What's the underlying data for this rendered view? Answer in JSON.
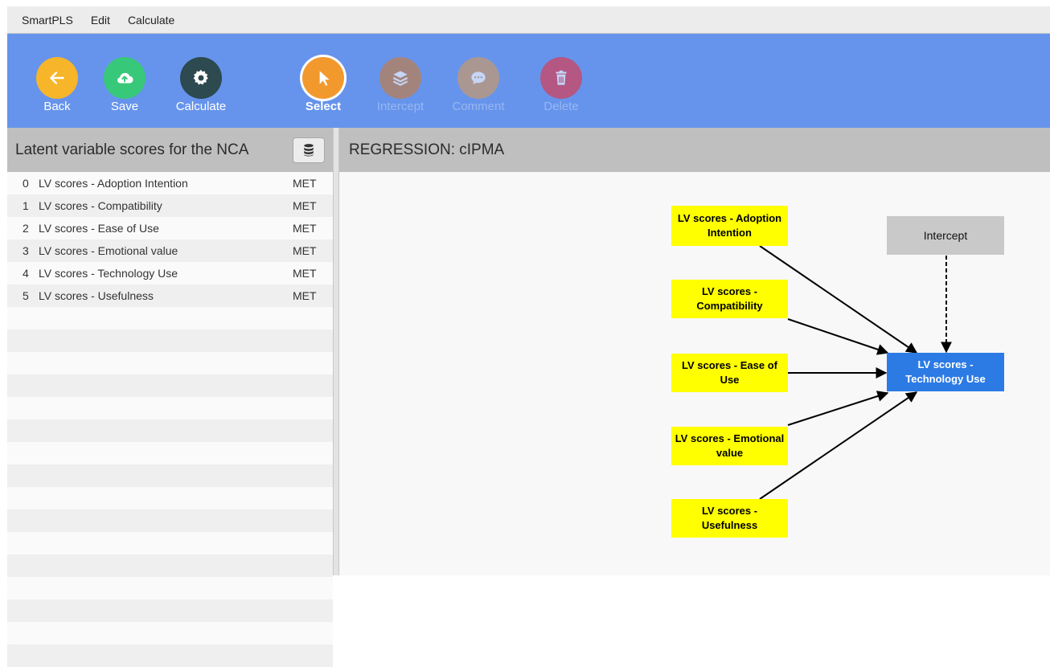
{
  "menu": [
    "SmartPLS",
    "Edit",
    "Calculate"
  ],
  "toolbar": {
    "back": "Back",
    "save": "Save",
    "calculate": "Calculate",
    "select": "Select",
    "intercept": "Intercept",
    "comment": "Comment",
    "delete": "Delete"
  },
  "colors": {
    "back": "#f7b529",
    "save": "#38c87a",
    "calculate": "#2c4a4f",
    "select": "#f2992e",
    "intercept": "#c97b3a",
    "comment": "#d49a5c",
    "delete": "#e53344"
  },
  "icons": {
    "back": "arrow-left-icon",
    "save": "cloud-upload-icon",
    "calculate": "gear-icon",
    "select": "cursor-arrow-icon",
    "intercept": "layers-icon",
    "comment": "speech-bubble-icon",
    "delete": "trash-icon",
    "database": "database-icon"
  },
  "left_panel": {
    "title": "Latent variable scores for the NCA",
    "items": [
      {
        "index": "0",
        "name": "LV scores - Adoption Intention",
        "type": "MET"
      },
      {
        "index": "1",
        "name": "LV scores - Compatibility",
        "type": "MET"
      },
      {
        "index": "2",
        "name": "LV scores - Ease of Use",
        "type": "MET"
      },
      {
        "index": "3",
        "name": "LV scores - Emotional  value",
        "type": "MET"
      },
      {
        "index": "4",
        "name": "LV scores - Technology Use",
        "type": "MET"
      },
      {
        "index": "5",
        "name": "LV scores - Usefulness",
        "type": "MET"
      }
    ]
  },
  "right_panel": {
    "title": "REGRESSION: cIPMA"
  },
  "diagram": {
    "nodes": {
      "adoption": "LV scores - Adoption Intention",
      "compat": "LV scores - Compatibility",
      "ease": "LV scores - Ease of Use",
      "emotional": "LV scores - Emotional  value",
      "useful": "LV scores - Usefulness",
      "target": "LV scores - Technology Use",
      "intercept": "Intercept"
    }
  }
}
